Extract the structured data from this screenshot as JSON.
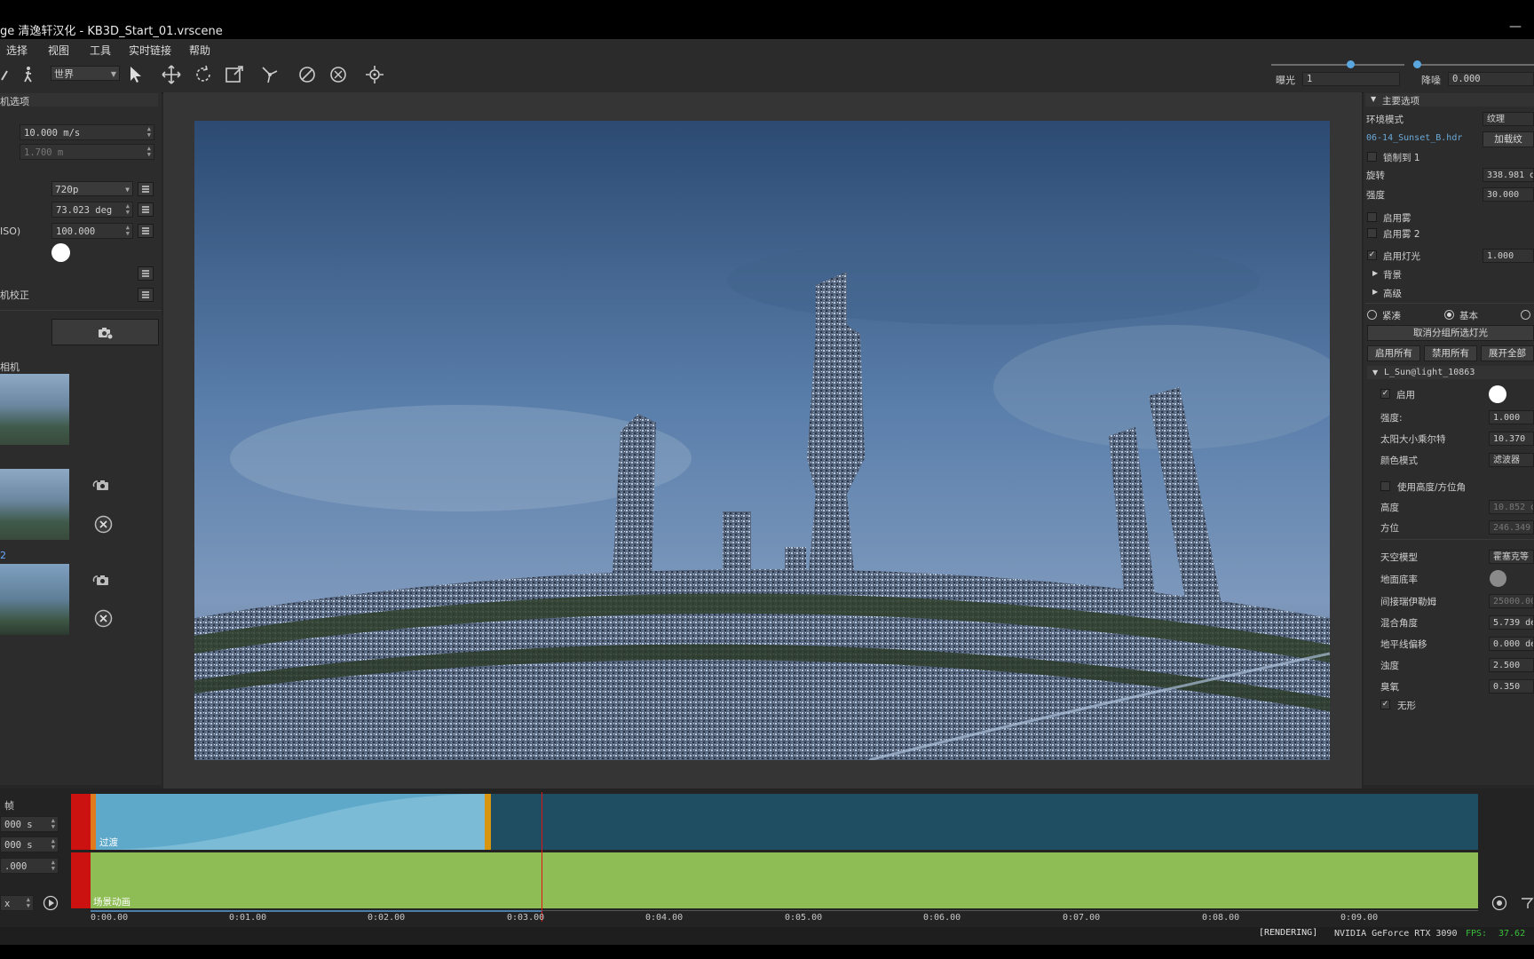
{
  "window": {
    "title": "ge 清逸轩汉化 - KB3D_Start_01.vrscene",
    "minimize": "—"
  },
  "menu": [
    "选择",
    "视图",
    "工具",
    "实时链接",
    "帮助"
  ],
  "toolbar": {
    "space_dropdown": "世界",
    "exposure_label": "曝光",
    "exposure_value": "1",
    "denoise_label": "降噪",
    "denoise_value": "0.000",
    "exposure_slider_level": 0.6
  },
  "left_panel": {
    "section_title": "机选项",
    "speed_value": "10.000 m/s",
    "height_value": "1.700 m",
    "resolution_value": "720p",
    "fov_value": "73.023 deg",
    "iso_label": "ISO)",
    "iso_value": "100.000",
    "camera_correction_label": "机校正",
    "cameras_label": "相机",
    "camera_index_label": "2"
  },
  "right_panel": {
    "section_main": "主要选项",
    "env_mode_label": "环境模式",
    "env_mode_value": "纹理",
    "hdr_file": "06-14_Sunset_B.hdr",
    "load_button": "加载纹",
    "lock_label": "锁制到 1",
    "rotate_label": "旋转",
    "rotate_value": "338.981 de",
    "intensity_label": "强度",
    "intensity_value": "30.000",
    "fog1_label": "启用雾",
    "fog2_label": "启用雾 2",
    "lights_label": "启用灯光",
    "lights_value": "1.000",
    "background_label": "背景",
    "advanced_label": "高级",
    "radio_compact": "紧凑",
    "radio_basic": "基本",
    "ungroup_button": "取消分组所选灯光",
    "enable_all": "启用所有",
    "disable_all": "禁用所有",
    "expand_all": "展开全部",
    "light_name": "L_Sun@light_10863",
    "enable_label": "启用",
    "strength_label": "强度:",
    "strength_value": "1.000",
    "sun_size_label": "太阳大小乘尔特",
    "sun_size_value": "10.370",
    "color_mode_label": "颜色模式",
    "color_mode_value": "滤波器",
    "use_alt_label": "使用高度/方位角",
    "altitude_label": "高度",
    "altitude_value": "10.852 d",
    "azimuth_label": "方位",
    "azimuth_value": "246.349",
    "sky_model_label": "天空模型",
    "sky_model_value": "霍塞克等",
    "ground_albedo_label": "地面底率",
    "indirect_label": "间接瑞伊勒姆",
    "indirect_value": "25000.00",
    "blend_angle_label": "混合角度",
    "blend_angle_value": "5.739 de",
    "horizon_label": "地平线偏移",
    "horizon_value": "0.000 de",
    "turbidity_label": "浊度",
    "turbidity_value": "2.500",
    "ozone_label": "臭氧",
    "ozone_value": "0.350",
    "invisible_label": "无形"
  },
  "timeline": {
    "frame_label": "帧",
    "start_value": "000 s",
    "end_value": "000 s",
    "fps_value": ".000",
    "speed_value": "x",
    "track1_label": "过渡",
    "track2_label": "场景动画",
    "ticks": [
      "0:00.00",
      "0:01.00",
      "0:02.00",
      "0:03.00",
      "0:04.00",
      "0:05.00",
      "0:06.00",
      "0:07.00",
      "0:08.00",
      "0:09.00"
    ],
    "playhead_time": "0:03.00"
  },
  "status": {
    "rendering": "[RENDERING]",
    "gpu": "NVIDIA GeForce RTX 3090",
    "fps_label": "FPS:",
    "fps_value": "37.62",
    "fps_color": "#3bbf3b"
  }
}
